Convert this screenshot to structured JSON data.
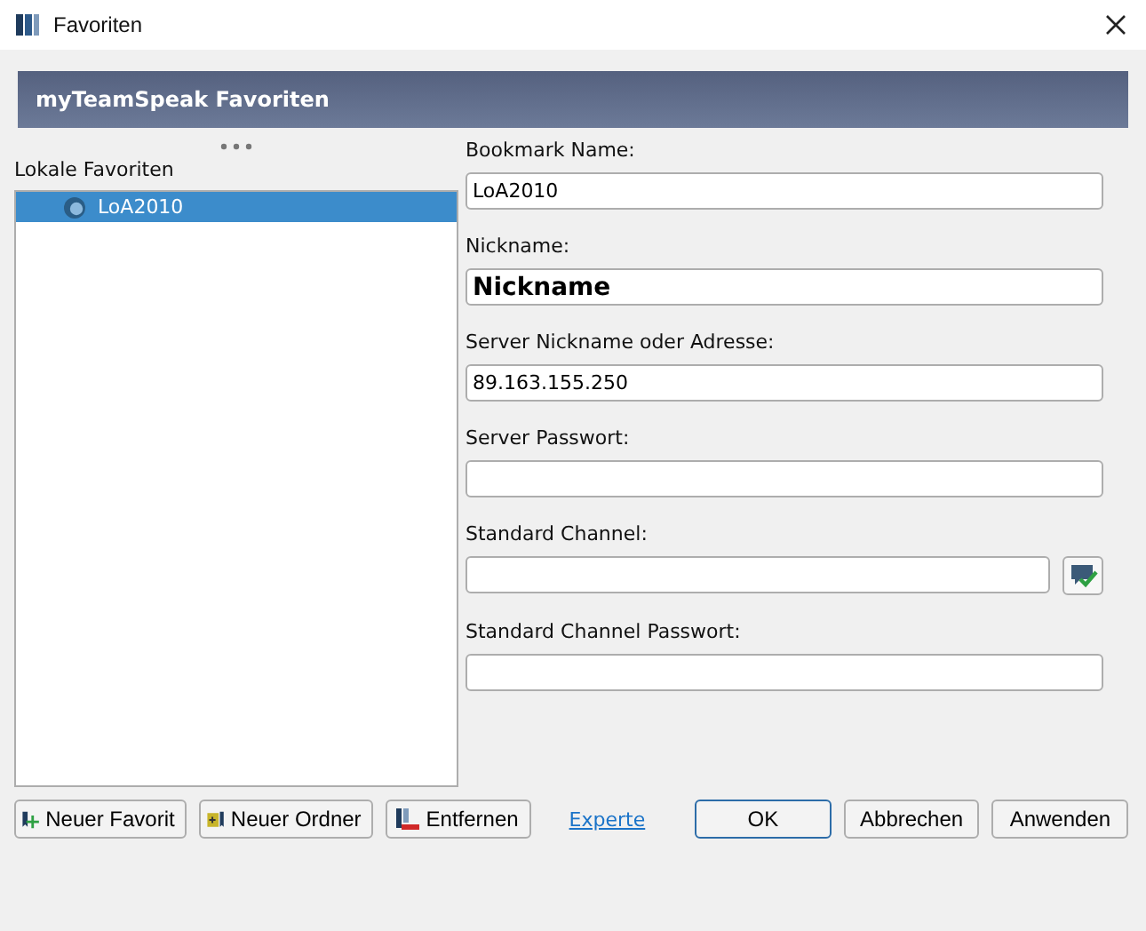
{
  "window": {
    "title": "Favoriten"
  },
  "header": {
    "title": "myTeamSpeak Favoriten"
  },
  "sidebar": {
    "title": "Lokale Favoriten",
    "items": [
      {
        "label": "LoA2010",
        "selected": true
      }
    ]
  },
  "fields": [
    {
      "kind": "text",
      "label": "Bookmark Name:",
      "value": "LoA2010"
    },
    {
      "kind": "bold",
      "label": "Nickname:",
      "value": "Nickname"
    },
    {
      "kind": "text",
      "label": "Server Nickname oder Adresse:",
      "value": "89.163.155.250"
    },
    {
      "kind": "text",
      "label": "Server Passwort:"
    },
    {
      "kind": "picker",
      "label": "Standard Channel:"
    },
    {
      "kind": "text",
      "label": "Standard Channel Passwort:"
    }
  ],
  "left_buttons": [
    {
      "kind": "add-favorite",
      "label": "Neuer Favorit"
    },
    {
      "kind": "add-folder",
      "label": "Neuer Ordner"
    },
    {
      "kind": "remove",
      "label": "Entfernen"
    }
  ],
  "link": "Experte",
  "buttons": [
    {
      "label": "OK",
      "default": true
    },
    {
      "label": "Abbrechen",
      "default": false
    },
    {
      "label": "Anwenden",
      "default": false
    }
  ]
}
